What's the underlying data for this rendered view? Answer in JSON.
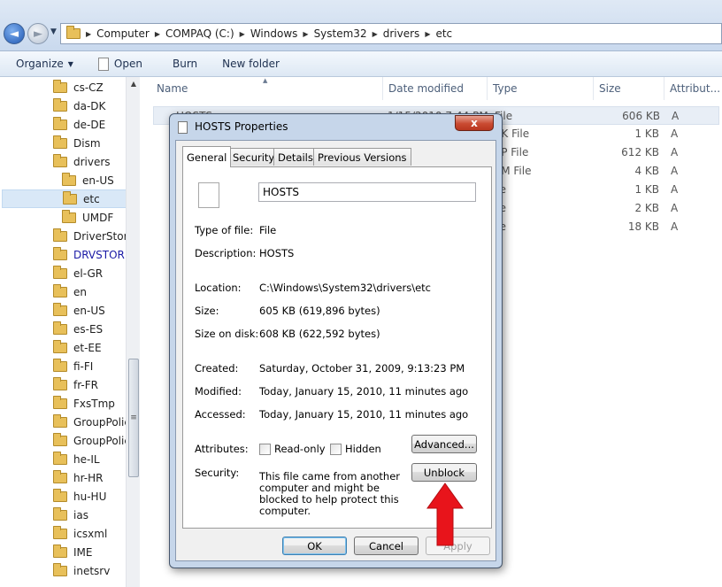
{
  "address_bar": {
    "crumbs": [
      "Computer",
      "COMPAQ (C:)",
      "Windows",
      "System32",
      "drivers",
      "etc"
    ]
  },
  "toolbar": {
    "organize": "Organize",
    "open": "Open",
    "burn": "Burn",
    "new_folder": "New folder"
  },
  "nav_pane": {
    "items": [
      {
        "label": "cs-CZ"
      },
      {
        "label": "da-DK"
      },
      {
        "label": "de-DE"
      },
      {
        "label": "Dism"
      },
      {
        "label": "drivers"
      },
      {
        "label": "en-US"
      },
      {
        "label": "etc"
      },
      {
        "label": "UMDF"
      },
      {
        "label": "DriverStore"
      },
      {
        "label": "DRVSTORE"
      },
      {
        "label": "el-GR"
      },
      {
        "label": "en"
      },
      {
        "label": "en-US"
      },
      {
        "label": "es-ES"
      },
      {
        "label": "et-EE"
      },
      {
        "label": "fi-FI"
      },
      {
        "label": "fr-FR"
      },
      {
        "label": "FxsTmp"
      },
      {
        "label": "GroupPolic"
      },
      {
        "label": "GroupPolic"
      },
      {
        "label": "he-IL"
      },
      {
        "label": "hr-HR"
      },
      {
        "label": "hu-HU"
      },
      {
        "label": "ias"
      },
      {
        "label": "icsxml"
      },
      {
        "label": "IME"
      },
      {
        "label": "inetsrv"
      }
    ]
  },
  "file_list": {
    "columns": [
      "Name",
      "Date modified",
      "Type",
      "Size",
      "Attribut..."
    ],
    "rows": [
      {
        "name": "HOSTS",
        "date": "1/15/2010 7:44 PM",
        "type": "File",
        "size": "606 KB",
        "attr": "A"
      },
      {
        "type": "CK File",
        "size": "1 KB",
        "attr": "A"
      },
      {
        "type": "VP File",
        "size": "612 KB",
        "attr": "A"
      },
      {
        "type": "AM File",
        "size": "4 KB",
        "attr": "A"
      },
      {
        "type": "ile",
        "size": "1 KB",
        "attr": "A"
      },
      {
        "type": "ile",
        "size": "2 KB",
        "attr": "A"
      },
      {
        "type": "ile",
        "size": "18 KB",
        "attr": "A"
      }
    ]
  },
  "dialog": {
    "title": "HOSTS Properties",
    "close": "x",
    "tabs": [
      "General",
      "Security",
      "Details",
      "Previous Versions"
    ],
    "file_name": "HOSTS",
    "type_label": "Type of file:",
    "type_value": "File",
    "desc_label": "Description:",
    "desc_value": "HOSTS",
    "location_label": "Location:",
    "location_value": "C:\\Windows\\System32\\drivers\\etc",
    "size_label": "Size:",
    "size_value": "605 KB (619,896 bytes)",
    "size_disk_label": "Size on disk:",
    "size_disk_value": "608 KB (622,592 bytes)",
    "created_label": "Created:",
    "created_value": "Saturday, October 31, 2009, 9:13:23 PM",
    "modified_label": "Modified:",
    "modified_value": "Today, January 15, 2010, 11 minutes ago",
    "accessed_label": "Accessed:",
    "accessed_value": "Today, January 15, 2010, 11 minutes ago",
    "attributes_label": "Attributes:",
    "readonly_label": "Read-only",
    "hidden_label": "Hidden",
    "advanced_button": "Advanced...",
    "security_label": "Security:",
    "security_text": "This file came from another computer and might be blocked to help protect this computer.",
    "unblock_button": "Unblock",
    "ok_button": "OK",
    "cancel_button": "Cancel",
    "apply_button": "Apply"
  },
  "colors": {
    "arrow": "#e8141b",
    "link_folder": "#1a1aa6"
  }
}
